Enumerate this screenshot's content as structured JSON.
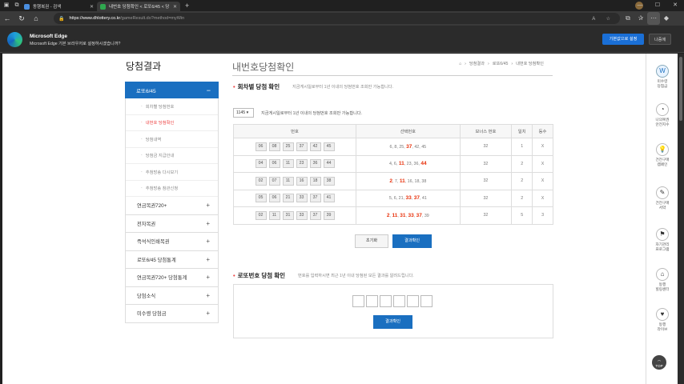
{
  "browser": {
    "tabs": [
      {
        "title": "동행복권 - 검색",
        "active": false
      },
      {
        "title": "내번호 당첨확인 < 로또6/45 < 당",
        "active": true
      }
    ],
    "url_host": "https://www.dhlottery.co.kr",
    "url_path": "/gameResult.do?method=myWin",
    "infobar_title": "Microsoft Edge",
    "infobar_desc": "Microsoft Edge 기본 브라우저로 설정하시겠습니까?",
    "set_default_label": "기본값으로 설정",
    "later_label": "나중에"
  },
  "page": {
    "side_title": "당첨결과",
    "main_title": "내번호당첨확인",
    "breadcrumb": [
      "당첨결과",
      "로또6/45",
      "내번호 당첨확인"
    ]
  },
  "sidebar": {
    "active": {
      "label": "로또6/45",
      "sub": [
        {
          "label": "회차별 당첨번호",
          "current": false
        },
        {
          "label": "내번호 당첨확인",
          "current": true
        },
        {
          "label": "당첨내역",
          "current": false
        },
        {
          "label": "당첨금 지급안내",
          "current": false
        },
        {
          "label": "추첨방송 다시보기",
          "current": false
        },
        {
          "label": "추첨방송 참관신청",
          "current": false
        }
      ]
    },
    "items": [
      "연금복권720+",
      "전자복권",
      "즉석식인쇄복권",
      "로또6/45 당첨통계",
      "연금복권720+ 당첨통계",
      "당첨소식",
      "미수령 당첨금"
    ]
  },
  "section1": {
    "title": "회차별 당첨 확인",
    "desc": "지금게시일로부터 1년 이내의 당첨번호 조회만 가능합니다.",
    "round_select": "1145 ▾",
    "select_desc": "지금게시일로부터 1년 이내의 당첨번호 조회만 가능합니다.",
    "headers": [
      "번호",
      "선택번호",
      "보너스 번호",
      "일치",
      "등수"
    ],
    "rows": [
      {
        "numbers": [
          "06",
          "08",
          "25",
          "37",
          "42",
          "45"
        ],
        "picked": [
          {
            "v": "6",
            "hit": false
          },
          {
            "v": "8",
            "hit": false
          },
          {
            "v": "25",
            "hit": false
          },
          {
            "v": "37",
            "hit": true
          },
          {
            "v": "42",
            "hit": false
          },
          {
            "v": "45",
            "hit": false
          }
        ],
        "bonus": "32",
        "match": "1",
        "rank": "X"
      },
      {
        "numbers": [
          "04",
          "06",
          "11",
          "23",
          "36",
          "44"
        ],
        "picked": [
          {
            "v": "4",
            "hit": false
          },
          {
            "v": "6",
            "hit": false
          },
          {
            "v": "11",
            "hit": true
          },
          {
            "v": "23",
            "hit": false
          },
          {
            "v": "36",
            "hit": false
          },
          {
            "v": "44",
            "hit": true
          }
        ],
        "bonus": "32",
        "match": "2",
        "rank": "X"
      },
      {
        "numbers": [
          "02",
          "07",
          "11",
          "16",
          "18",
          "38"
        ],
        "picked": [
          {
            "v": "2",
            "hit": true
          },
          {
            "v": "7",
            "hit": false
          },
          {
            "v": "11",
            "hit": true
          },
          {
            "v": "16",
            "hit": false
          },
          {
            "v": "18",
            "hit": false
          },
          {
            "v": "38",
            "hit": false
          }
        ],
        "bonus": "32",
        "match": "2",
        "rank": "X"
      },
      {
        "numbers": [
          "05",
          "06",
          "21",
          "33",
          "37",
          "41"
        ],
        "picked": [
          {
            "v": "5",
            "hit": false
          },
          {
            "v": "6",
            "hit": false
          },
          {
            "v": "21",
            "hit": false
          },
          {
            "v": "33",
            "hit": true
          },
          {
            "v": "37",
            "hit": true
          },
          {
            "v": "41",
            "hit": false
          }
        ],
        "bonus": "32",
        "match": "2",
        "rank": "X"
      },
      {
        "numbers": [
          "02",
          "11",
          "31",
          "33",
          "37",
          "39"
        ],
        "picked": [
          {
            "v": "2",
            "hit": true
          },
          {
            "v": "11",
            "hit": true
          },
          {
            "v": "31",
            "hit": true
          },
          {
            "v": "33",
            "hit": true
          },
          {
            "v": "37",
            "hit": true
          },
          {
            "v": "39",
            "hit": false
          }
        ],
        "bonus": "32",
        "match": "5",
        "rank": "3"
      }
    ],
    "reset_label": "초기화",
    "check_label": "결과확인"
  },
  "section2": {
    "title": "로또번호 당첨 확인",
    "desc": "번호를 입력하시면 최근 1년 이내 당첨된 모든 결과를 알려드립니다.",
    "check_label": "결과확인"
  },
  "rail": [
    {
      "label": "미수령\n당첨금",
      "icon": "W"
    },
    {
      "label": "나의복권\n안전지수",
      "icon": "◔"
    },
    {
      "label": "건전구매\n캠페인",
      "icon": "💡"
    },
    {
      "label": "건전구매\n서약",
      "icon": "✎"
    },
    {
      "label": "자기관리\n프로그램",
      "icon": "⚑"
    },
    {
      "label": "동행\n힐링센터",
      "icon": "⌂"
    },
    {
      "label": "동행\n라이브",
      "icon": "♥"
    }
  ],
  "top_label": "TOP"
}
